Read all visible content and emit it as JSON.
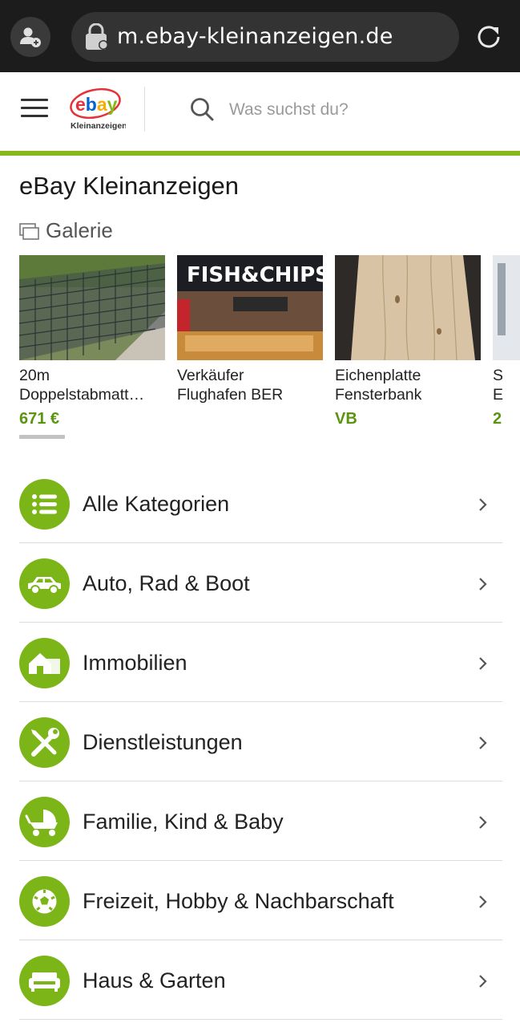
{
  "browser": {
    "url": "m.ebay-kleinanzeigen.de"
  },
  "header": {
    "logo_text": "Kleinanzeigen",
    "search_placeholder": "Was suchst du?"
  },
  "main": {
    "title": "eBay Kleinanzeigen",
    "gallery_label": "Galerie",
    "gallery_items": [
      {
        "title_line1": "20m",
        "title_line2": "Doppelstabmatt…",
        "price": "671 €"
      },
      {
        "title_line1": "Verkäufer",
        "title_line2": "Flughafen BER",
        "price": ""
      },
      {
        "title_line1": "Eichenplatte",
        "title_line2": "Fensterbank",
        "price": "VB"
      },
      {
        "title_line1": "S",
        "title_line2": "E",
        "price": "2"
      }
    ]
  },
  "categories": [
    {
      "label": "Alle Kategorien",
      "icon": "list-icon"
    },
    {
      "label": "Auto, Rad & Boot",
      "icon": "car-icon"
    },
    {
      "label": "Immobilien",
      "icon": "house-icon"
    },
    {
      "label": "Dienstleistungen",
      "icon": "tools-icon"
    },
    {
      "label": "Familie, Kind & Baby",
      "icon": "stroller-icon"
    },
    {
      "label": "Freizeit, Hobby & Nachbarschaft",
      "icon": "football-icon"
    },
    {
      "label": "Haus & Garten",
      "icon": "sofa-icon"
    }
  ],
  "colors": {
    "accent_green": "#86b817",
    "price_green": "#5a9410",
    "browser_bar": "#1c1c1c"
  }
}
